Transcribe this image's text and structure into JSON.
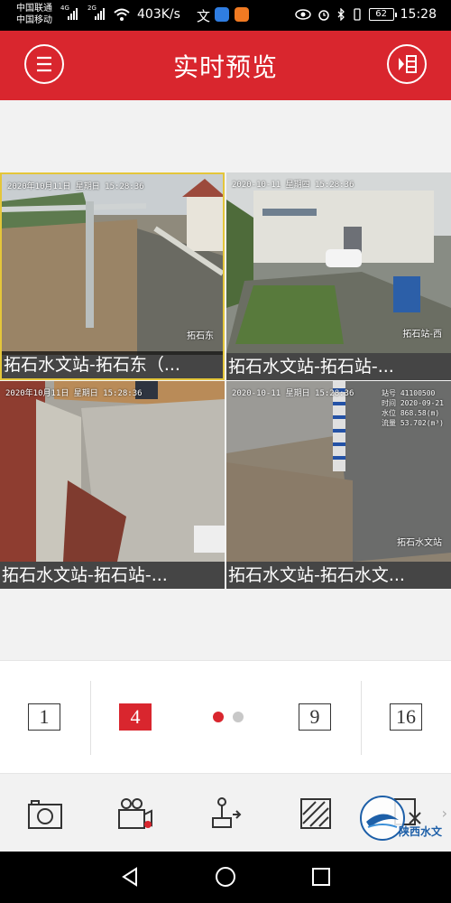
{
  "status_bar": {
    "carrier1": "中国联通",
    "carrier2": "中国移动",
    "net1": "4G",
    "net2": "2G",
    "speed": "403K/s",
    "battery": "62",
    "time": "15:28"
  },
  "header": {
    "title": "实时预览",
    "menu_icon": "hamburger-menu-icon",
    "playback_icon": "playback-list-icon"
  },
  "cameras": [
    {
      "label": "拓石水文站-拓石东（...",
      "timestamp": "2020年10月11日 星期日 15:28:36",
      "name_overlay": "拓石东",
      "side_text": []
    },
    {
      "label": "拓石水文站-拓石站-...",
      "timestamp": "2020-10-11 星期四 15:28:36",
      "name_overlay": "拓石站-西",
      "side_text": []
    },
    {
      "label": "拓石水文站-拓石站-...",
      "timestamp": "2020年10月11日 星期日 15:28:36",
      "name_overlay": "",
      "side_text": []
    },
    {
      "label": "拓石水文站-拓石水文...",
      "timestamp": "2020-10-11 星期日 15:28:36",
      "name_overlay": "拓石水文站",
      "side_text": [
        "站号 41100500",
        "时间 2020-09-21",
        "水位 868.58(m)",
        "流量 53.702(m³)"
      ]
    }
  ],
  "split_options": [
    {
      "label": "1",
      "active": false
    },
    {
      "label": "4",
      "active": true
    },
    {
      "label": "9",
      "active": false
    },
    {
      "label": "16",
      "active": false
    }
  ],
  "page_indicator": {
    "pages": 2,
    "current": 1
  },
  "toolbar": {
    "items": [
      "camera-snapshot-icon",
      "video-record-icon",
      "ptz-joystick-icon",
      "image-quality-icon",
      "close-window-icon"
    ],
    "more": "›"
  },
  "watermark": {
    "text": "陕西水文"
  },
  "colors": {
    "brand_red": "#d9262e",
    "selected_border": "#e4c63a"
  }
}
